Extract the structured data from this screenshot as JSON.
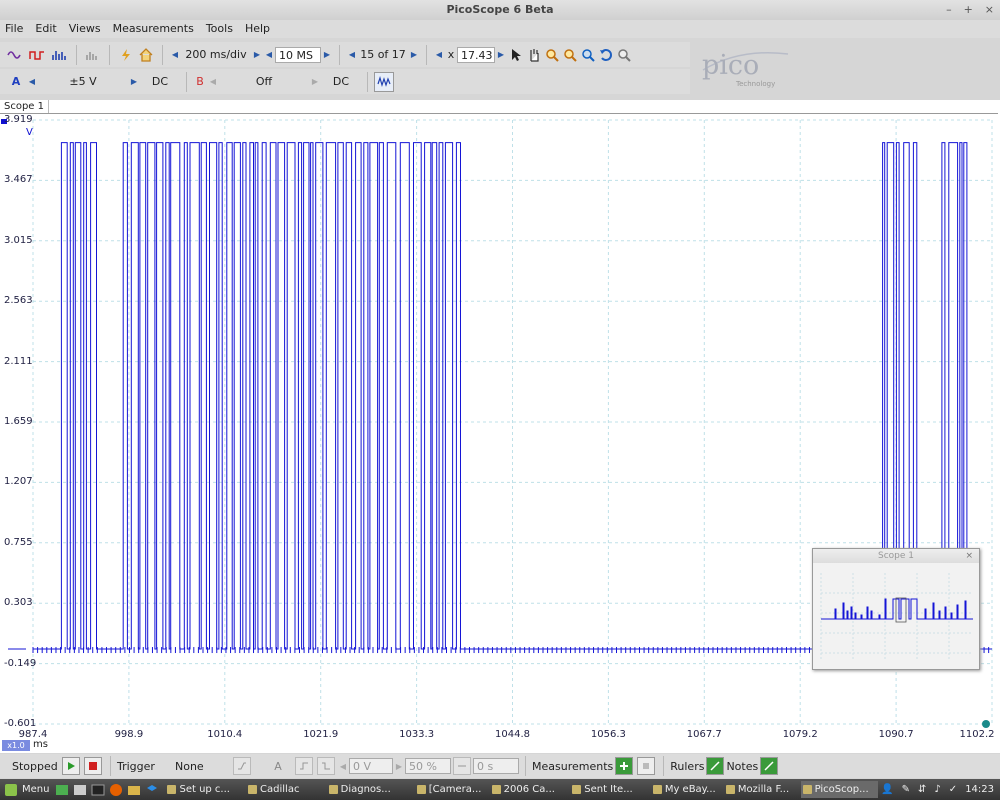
{
  "window": {
    "title": "PicoScope 6 Beta",
    "min": "–",
    "max": "+",
    "close": "×"
  },
  "menu": [
    "File",
    "Edit",
    "Views",
    "Measurements",
    "Tools",
    "Help"
  ],
  "toolbar1": {
    "timebase": "200 ms/div",
    "samples": "10 MS",
    "buffer": "15 of 17",
    "zoom_prefix": "x",
    "zoom": "17.43"
  },
  "toolbar2": {
    "ch_a": "A",
    "range_a": "±5 V",
    "coupling_a": "DC",
    "ch_b": "B",
    "range_b": "Off",
    "coupling_b": "DC"
  },
  "logo": {
    "text": "pico",
    "sub": "Technology"
  },
  "scope": {
    "tab": "Scope 1",
    "unit": "V",
    "x_unit": "ms",
    "zoom_badge": "x1.0",
    "overview_title": "Scope 1"
  },
  "chart_data": {
    "type": "line",
    "title": "",
    "yticks": [
      "3.919",
      "3.467",
      "3.015",
      "2.563",
      "2.111",
      "1.659",
      "1.207",
      "0.755",
      "0.303",
      "-0.149",
      "-0.601"
    ],
    "xticks": [
      "987.4",
      "998.9",
      "1010.4",
      "1021.9",
      "1033.3",
      "1044.8",
      "1056.3",
      "1067.7",
      "1079.2",
      "1090.7",
      "1102.2"
    ],
    "ylim": [
      -0.601,
      3.919
    ],
    "xlim": [
      987.4,
      1102.2
    ],
    "grid": true,
    "series": [
      {
        "color": "#1414d6",
        "high": 3.75,
        "low": -0.04,
        "bursts": [
          [
            990.8,
            995.0
          ],
          [
            998.2,
            1013.8
          ],
          [
            1014.0,
            1039.1
          ],
          [
            1089.1,
            1093.2
          ],
          [
            1096.2,
            1099.2
          ]
        ]
      }
    ]
  },
  "status": {
    "state": "Stopped",
    "trigger_label": "Trigger",
    "trigger_mode": "None",
    "channel": "A",
    "level": "0 V",
    "pretrigger": "50 %",
    "delay": "0 s",
    "measurements": "Measurements",
    "rulers": "Rulers",
    "notes": "Notes"
  },
  "taskbar": {
    "menu": "Menu",
    "tasks": [
      "Set up c...",
      "Cadillac",
      "Diagnos...",
      "[Camera...",
      "2006 Ca...",
      "Sent Ite...",
      "My eBay...",
      "Mozilla F...",
      "PicoScop..."
    ],
    "clock": "14:23"
  }
}
